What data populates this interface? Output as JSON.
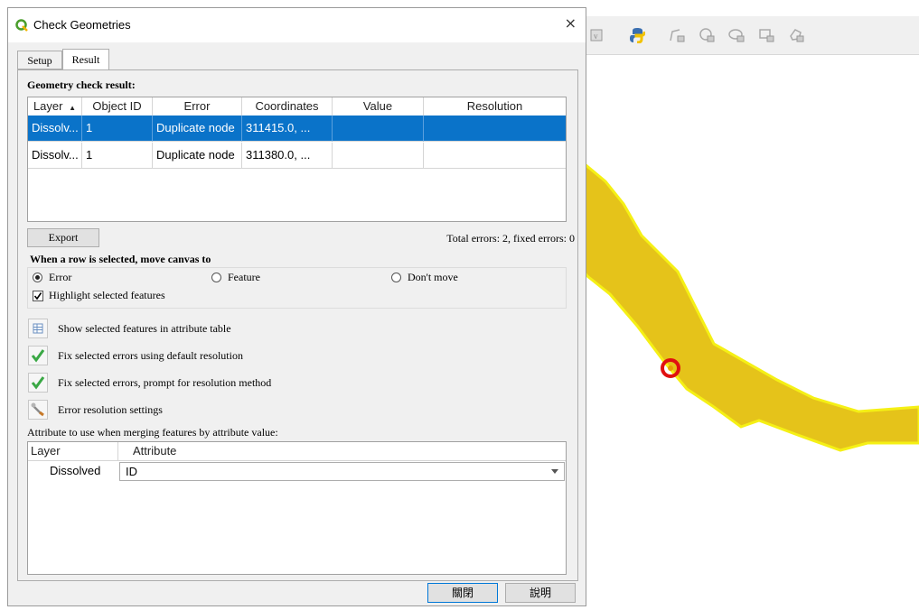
{
  "dialog": {
    "title": "Check Geometries",
    "close_glyph": "×"
  },
  "tabs": [
    {
      "label": "Setup"
    },
    {
      "label": "Result"
    }
  ],
  "result": {
    "heading": "Geometry check result:",
    "columns": [
      "Layer",
      "Object ID",
      "Error",
      "Coordinates",
      "Value",
      "Resolution"
    ],
    "sort_glyph": "▲",
    "rows": [
      {
        "layer": "Dissolv...",
        "object_id": "1",
        "error": "Duplicate node",
        "coordinates": "311415.0, ...",
        "value": "",
        "resolution": "",
        "selected": true
      },
      {
        "layer": "Dissolv...",
        "object_id": "1",
        "error": "Duplicate node",
        "coordinates": "311380.0, ...",
        "value": "",
        "resolution": "",
        "selected": false
      }
    ],
    "export_label": "Export",
    "totals": "Total errors: 2, fixed errors: 0"
  },
  "move_canvas": {
    "heading": "When a row is selected, move canvas to",
    "options": [
      {
        "label": "Error",
        "checked": true
      },
      {
        "label": "Feature",
        "checked": false
      },
      {
        "label": "Don't move",
        "checked": false,
        "underline": "m"
      }
    ],
    "highlight_label": "Highlight selected features",
    "highlight_checked": true
  },
  "actions": [
    {
      "label": "Show selected features in attribute table",
      "icon": "attribute-table-icon"
    },
    {
      "label": "Fix selected errors using default resolution",
      "icon": "checkmark-icon"
    },
    {
      "label": "Fix selected errors, prompt for resolution method",
      "icon": "checkmark-icon"
    },
    {
      "label": "Error resolution settings",
      "icon": "wrench-icon"
    }
  ],
  "merge": {
    "heading": "Attribute to use when merging features by attribute value:",
    "columns": [
      "Layer",
      "Attribute"
    ],
    "rows": [
      {
        "layer": "Dissolved",
        "attribute": "ID"
      }
    ]
  },
  "footer": {
    "close_label": "關閉",
    "help_label": "說明"
  },
  "colors": {
    "selection": "#0a73c9",
    "feature_fill": "#e5c31a",
    "feature_outline": "#f5f015",
    "marker_red": "#e01010"
  }
}
